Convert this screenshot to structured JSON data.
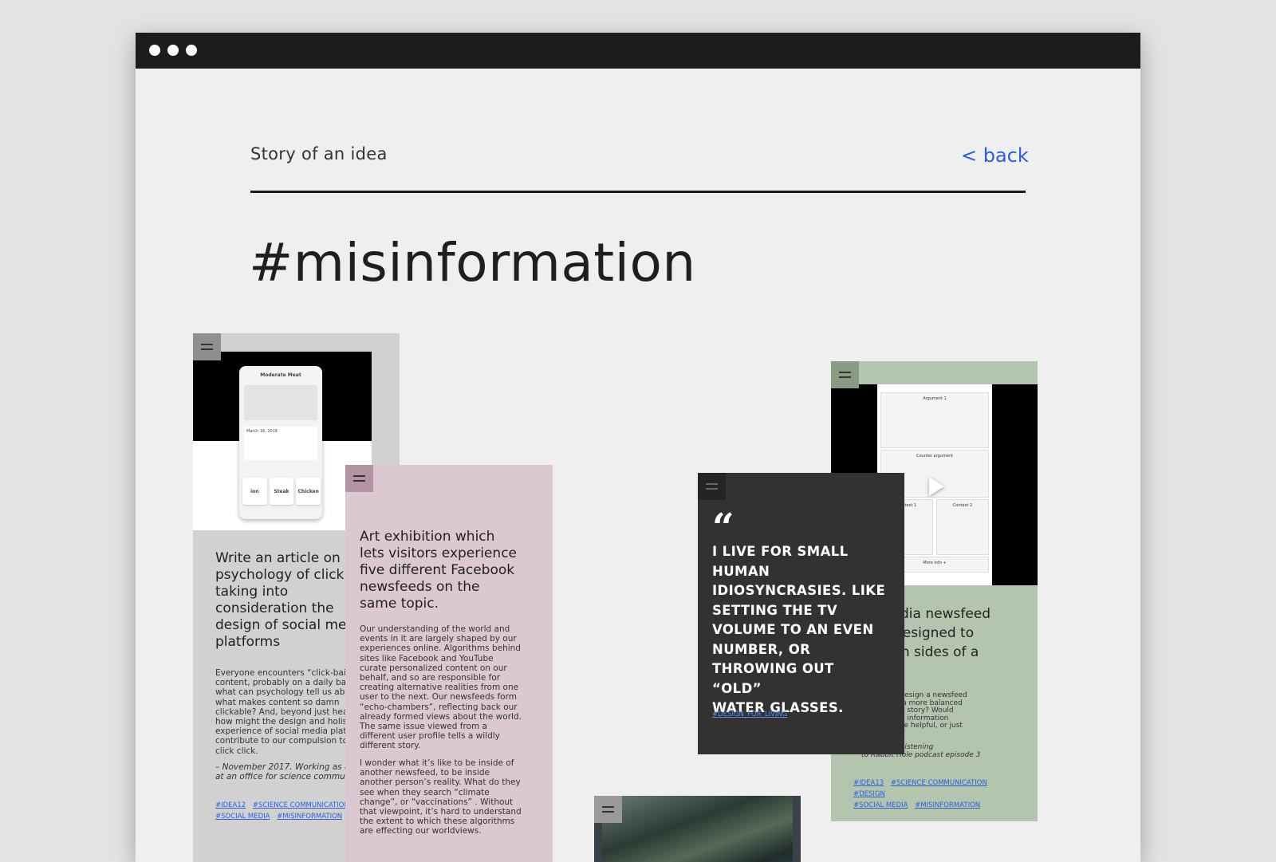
{
  "header": {
    "label": "Story of an idea",
    "back_label": "< back"
  },
  "page_title": "#misinformation",
  "cards": {
    "article": {
      "phone_title": "Moderate Meat",
      "phone_date": "March 16, 2016",
      "phone_foods": [
        "ion",
        "Steak",
        "Chicken"
      ],
      "title": "Write an article on\npsychology of click\ntaking into\nconsideration the\ndesign of social me\nplatforms",
      "body": "Everyone encounters “click-bai\ncontent, probably on a daily ba\nwhat can psychology tell us abo\nwhat makes content so damn\nclickable? And, beyond just hea\nhow might the design and holis\nexperience of social media plat\ncontribute to our compulsion to\nclick click.",
      "note": "– November 2017. Working as a\nat an office for science commun",
      "tags": [
        "#IDEA12",
        "#SCIENCE COMMUNICATION",
        "#SOCIAL MEDIA",
        "#MISINFORMATION"
      ]
    },
    "exhibition": {
      "title": "Art exhibition which\nlets visitors experience\nfive different Facebook\nnewsfeeds on the\nsame topic.",
      "body": "Our understanding of the world and\nevents in it are largely shaped by our\nexperiences online. Algorithms behind\nsites like Facebook and YouTube\ncurate personalized content on our\nbehalf, and so are responsible for\ncreating alternative realities from one\nuser to the next. Our newsfeeds form\n“echo-chambers”, reflecting back our\nalready formed views about the world.\nThe same issue viewed from a\ndifferent user profile tells a wildly\ndifferent story.",
      "body2": "I wonder what it’s like to be inside of\nanother newsfeed, to be inside\nanother person’s reality. What do they\nsee when they search “climate\nchange”, or “vaccinations” . Without\nthat viewpoint, it’s hard to understand\nthe extent to which these algorithms\nare effecting our worldviews."
    },
    "newsfeed": {
      "screen_labels": [
        "Argument 1",
        "Counter argument",
        "Context 1",
        "Context 2",
        "More info +"
      ],
      "title": "media newsfeed\nis designed to\nboth sides of a",
      "body": "e design a newsfeed\nts a more balanced\nery story? Would\nore information\nc be helpful, or just\nse?",
      "note": "@1:53pm. Listening\nto Rabbit Hole podcast episode 3",
      "tags": [
        "#IDEA13",
        "#SCIENCE COMMUNICATION",
        "#DESIGN",
        "#SOCIAL MEDIA",
        "#MISINFORMATION"
      ]
    },
    "quote": {
      "mark": "“",
      "text": "I LIVE FOR SMALL\nHUMAN\nIDIOSYNCRASIES. LIKE\nSETTING THE TV\nVOLUME TO AN EVEN\nNUMBER, OR\nTHROWING OUT “OLD”\nWATER GLASSES.",
      "tag": "#DESIGN_FOR_LIVING"
    }
  },
  "colors": {
    "accent_link": "#2c5fd6",
    "titlebar": "#1c1c1c",
    "card_gray": "#d1d1d1",
    "card_pink": "#dcc8d1",
    "card_green": "#b4c5af",
    "card_dark": "#323232"
  },
  "icons": {
    "window_controls": "dot",
    "card_handle": "drag-handle-icon",
    "play": "play-icon",
    "quote": "quote-icon"
  }
}
